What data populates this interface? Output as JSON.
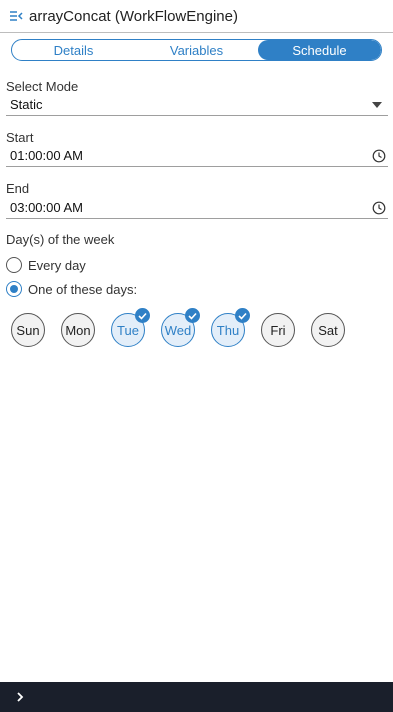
{
  "header": {
    "title": "arrayConcat (WorkFlowEngine)",
    "back_icon": "collapse-panel-icon"
  },
  "tabs": [
    {
      "label": "Details",
      "active": false
    },
    {
      "label": "Variables",
      "active": false
    },
    {
      "label": "Schedule",
      "active": true
    }
  ],
  "select_mode": {
    "label": "Select Mode",
    "value": "Static"
  },
  "start": {
    "label": "Start",
    "value": "01:00:00 AM"
  },
  "end": {
    "label": "End",
    "value": "03:00:00 AM"
  },
  "days_section": {
    "label": "Day(s) of the week",
    "options": [
      {
        "label": "Every day",
        "checked": false
      },
      {
        "label": "One of these days:",
        "checked": true
      }
    ]
  },
  "days": [
    {
      "label": "Sun",
      "selected": false
    },
    {
      "label": "Mon",
      "selected": false
    },
    {
      "label": "Tue",
      "selected": true
    },
    {
      "label": "Wed",
      "selected": true
    },
    {
      "label": "Thu",
      "selected": true
    },
    {
      "label": "Fri",
      "selected": false
    },
    {
      "label": "Sat",
      "selected": false
    }
  ],
  "colors": {
    "accent": "#2f80c6",
    "footer_bg": "#1a1f2b"
  },
  "footer": {
    "expand_icon": "chevron-right-icon"
  }
}
